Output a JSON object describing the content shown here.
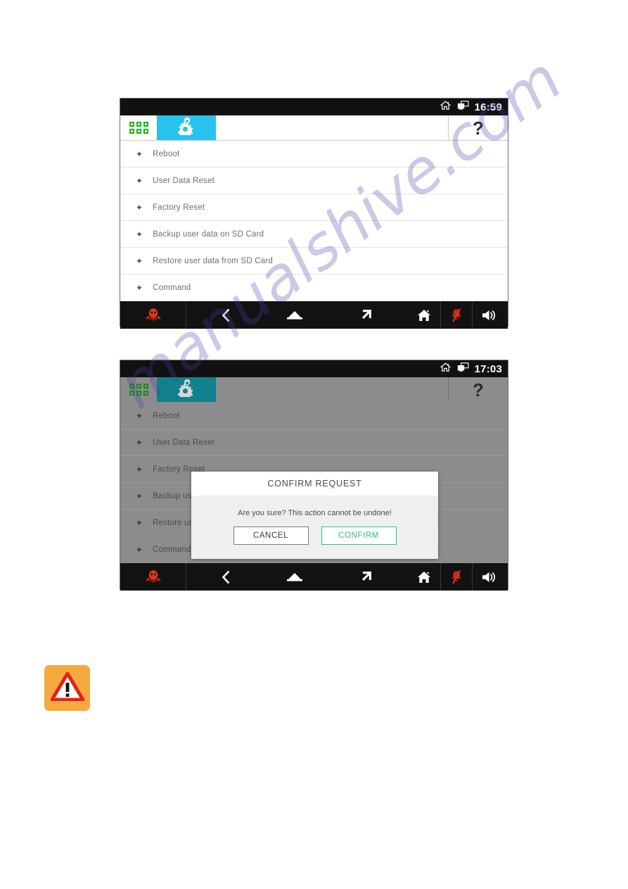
{
  "watermark": {
    "text": "manualshive.com"
  },
  "screens": [
    {
      "id": "settings-menu",
      "statusbar": {
        "time": "16:59",
        "icons": [
          "home-icon",
          "remote-display-icon"
        ]
      },
      "tabbar": {
        "apps_tab": "apps-grid-icon",
        "settings_tab": "gears-icon",
        "help_label": "?"
      },
      "menu": [
        {
          "label": "Reboot"
        },
        {
          "label": "User Data Reset"
        },
        {
          "label": "Factory Reset"
        },
        {
          "label": "Backup user data on SD Card"
        },
        {
          "label": "Restore user data from SD Card"
        },
        {
          "label": "Command"
        }
      ],
      "navbar": {
        "logo": "octopus-logo-icon",
        "buttons": [
          "back-icon",
          "home-pentagon-icon",
          "recents-arrow-icon",
          "house-icon",
          "bell-muted-icon",
          "volume-icon"
        ]
      },
      "dialog": null
    },
    {
      "id": "settings-menu-confirm",
      "statusbar": {
        "time": "17:03",
        "icons": [
          "home-icon",
          "remote-display-icon"
        ]
      },
      "tabbar": {
        "apps_tab": "apps-grid-icon",
        "settings_tab": "gears-icon",
        "help_label": "?"
      },
      "menu": [
        {
          "label": "Reboot"
        },
        {
          "label": "User Data Reset"
        },
        {
          "label": "Factory Reset"
        },
        {
          "label": "Backup user data on SD Card"
        },
        {
          "label": "Restore user data from SD Card"
        },
        {
          "label": "Command"
        }
      ],
      "navbar": {
        "logo": "octopus-logo-icon",
        "buttons": [
          "back-icon",
          "home-pentagon-icon",
          "recents-arrow-icon",
          "house-icon",
          "bell-muted-icon",
          "volume-icon"
        ]
      },
      "dialog": {
        "title": "CONFIRM REQUEST",
        "message": "Are you sure? This action cannot be undone!",
        "cancel_label": "CANCEL",
        "confirm_label": "CONFIRM"
      }
    }
  ],
  "warning": {
    "icon": "warning-triangle-icon"
  },
  "colors": {
    "accent_cyan": "#29c2ef",
    "accent_cyan_dim": "#11808f",
    "grid_green": "#16b81c",
    "confirm_green": "#2fbf7e",
    "logo_red": "#e8321a",
    "warn_orange": "#f5a93f",
    "statusbar_black": "#111111"
  }
}
